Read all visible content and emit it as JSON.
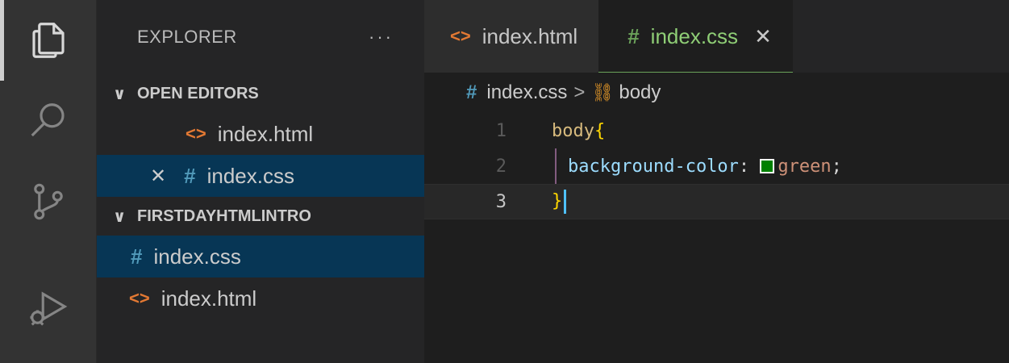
{
  "colors": {
    "html_icon": "#e37933",
    "css_icon": "#519aba",
    "selection": "#073655",
    "swatch_green": "#008000"
  },
  "activity_bar": {
    "items": [
      {
        "icon": "files-icon",
        "active": true
      },
      {
        "icon": "search-icon",
        "active": false
      },
      {
        "icon": "source-control-icon",
        "active": false
      },
      {
        "icon": "run-debug-icon",
        "active": false
      }
    ]
  },
  "sidebar": {
    "title": "EXPLORER",
    "more": "···",
    "open_editors": {
      "label": "OPEN EDITORS",
      "items": [
        {
          "name": "index.html",
          "icon": "<>",
          "selected": false
        },
        {
          "name": "index.css",
          "icon": "#",
          "close": "✕",
          "selected": true
        }
      ]
    },
    "folder": {
      "label": "FIRSTDAYHTMLINTRO",
      "items": [
        {
          "name": "index.css",
          "icon": "#",
          "selected": true
        },
        {
          "name": "index.html",
          "icon": "<>",
          "selected": false
        }
      ]
    }
  },
  "tabs": [
    {
      "name": "index.html",
      "icon": "<>",
      "active": false
    },
    {
      "name": "index.css",
      "icon": "#",
      "active": true,
      "close": "✕"
    }
  ],
  "breadcrumb": {
    "file_icon": "#",
    "file": "index.css",
    "separator": ">",
    "symbol_icon": "⛓",
    "symbol": "body"
  },
  "code": {
    "lines": [
      {
        "num": "1",
        "selector": "body",
        "open": "{"
      },
      {
        "num": "2",
        "property": "background-color",
        "colon": ":",
        "value": "green",
        "semi": ";"
      },
      {
        "num": "3",
        "close": "}"
      }
    ]
  }
}
